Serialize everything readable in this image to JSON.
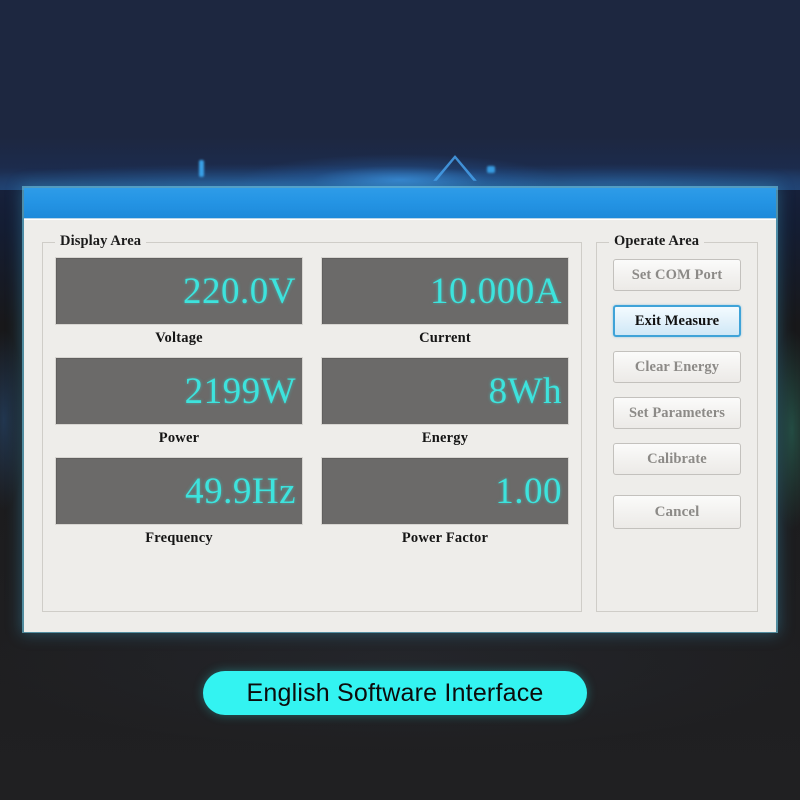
{
  "window": {
    "title_bar_color": "#2494e4",
    "title": ""
  },
  "display_area": {
    "legend": "Display Area",
    "meters": [
      {
        "value": "220.0V",
        "label": "Voltage"
      },
      {
        "value": "10.000A",
        "label": "Current"
      },
      {
        "value": "2199W",
        "label": "Power"
      },
      {
        "value": "8Wh",
        "label": "Energy"
      },
      {
        "value": "49.9Hz",
        "label": "Frequency"
      },
      {
        "value": "1.00",
        "label": "Power Factor"
      }
    ],
    "display_bg_color": "#6b6a69",
    "value_color": "#3de3dd"
  },
  "operate_area": {
    "legend": "Operate Area",
    "buttons": [
      {
        "label": "Set COM Port",
        "state": "disabled"
      },
      {
        "label": "Exit Measure",
        "state": "active"
      },
      {
        "label": "Clear Energy",
        "state": "disabled"
      },
      {
        "label": "Set Parameters",
        "state": "disabled"
      },
      {
        "label": "Calibrate",
        "state": "disabled"
      }
    ],
    "cancel": {
      "label": "Cancel",
      "state": "disabled"
    },
    "active_border_color": "#3fa3d8"
  },
  "caption": {
    "text": "English Software Interface",
    "pill_color": "#33f3f1",
    "text_color": "#0c0c0c"
  }
}
